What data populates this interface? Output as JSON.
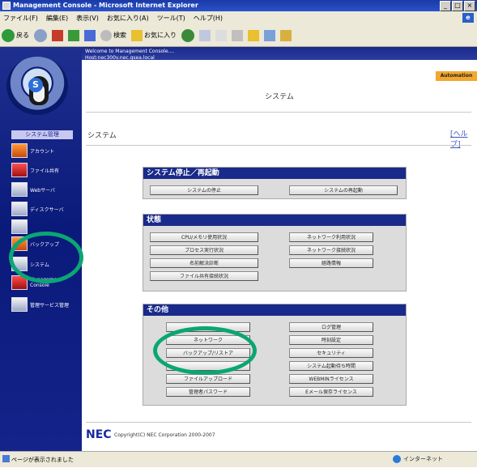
{
  "window": {
    "title": "Management Console - Microsoft Internet Explorer",
    "buttons": [
      "_",
      "□",
      "×"
    ]
  },
  "menubar": {
    "items": [
      "ファイル(F)",
      "編集(E)",
      "表示(V)",
      "お気に入り(A)",
      "ツール(T)",
      "ヘルプ(H)"
    ]
  },
  "toolbar": {
    "back_label": "戻る",
    "search_label": "検索",
    "favorites_label": "お気に入り"
  },
  "banner": {
    "line1": "Welcome to Management Console....",
    "line2": "Host:nec300v.nec.gsea.local",
    "automation_tab": "Automation"
  },
  "sidebar": {
    "header": "システム管理",
    "items": [
      {
        "label": "アカウント",
        "icon": "users-icon"
      },
      {
        "label": "ファイル共有",
        "icon": "folder-share-icon"
      },
      {
        "label": "Webサーバ",
        "icon": "web-icon"
      },
      {
        "label": "ディスクサーバ",
        "icon": "disk-icon"
      },
      {
        "label": "",
        "icon": "tool-icon"
      },
      {
        "label": "バックアップ",
        "icon": "backup-icon"
      },
      {
        "label": "システム",
        "icon": "system-icon"
      },
      {
        "label": "Management Console",
        "icon": "console-icon"
      },
      {
        "label": "管理サービス管理",
        "icon": "service-icon"
      }
    ]
  },
  "page": {
    "title": "システム",
    "breadcrumb": "システム",
    "help": "[ヘルプ]"
  },
  "sections": {
    "shutdown": {
      "title": "システム停止／再起動",
      "buttons": [
        "システムの停止",
        "システムの再起動"
      ]
    },
    "status": {
      "title": "状態",
      "buttons": [
        "CPU/メモリ使用状況",
        "ネットワーク利用状況",
        "プロセス実行状況",
        "ネットワーク接続状況",
        "名前解決診断",
        "経路情報",
        "ファイル共有接続状況"
      ]
    },
    "other": {
      "title": "その他",
      "buttons": [
        "",
        "ログ管理",
        "ネットワーク",
        "時刻設定",
        "バックアップ/リストア",
        "セキュリティ",
        "",
        "システム起動待ち時間",
        "ファイルアップロード",
        "WEBMINライセンス",
        "管理者パスワード",
        "Eメール保存ライセンス"
      ]
    }
  },
  "footer": {
    "logo": "NEC",
    "copyright": "Copyright(C) NEC Corporation 2000-2007"
  },
  "statusbar": {
    "text": "ページが表示されました",
    "zone": "インターネット"
  },
  "colors": {
    "nav_bg": "#0a1a7a",
    "panel_head": "#1a2a8a",
    "highlight_ring": "#0aa673",
    "automation_tab": "#f2a830"
  }
}
